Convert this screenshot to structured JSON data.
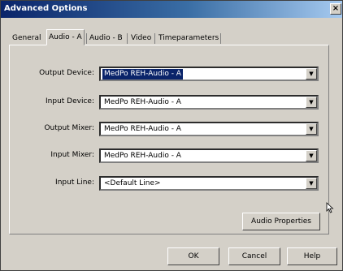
{
  "window": {
    "title": "Advanced Options",
    "close_label": "×"
  },
  "tabs": [
    {
      "label": "General",
      "active": false
    },
    {
      "label": "Audio - A",
      "active": true
    },
    {
      "label": "Audio - B",
      "active": false
    },
    {
      "label": "Video",
      "active": false
    },
    {
      "label": "Timeparameters",
      "active": false
    }
  ],
  "fields": [
    {
      "label": "Output Device:",
      "value": "MedPo REH-Audio - A",
      "selected": true
    },
    {
      "label": "Input Device:",
      "value": "MedPo REH-Audio - A",
      "selected": false
    },
    {
      "label": "Output Mixer:",
      "value": "MedPo REH-Audio - A",
      "selected": false
    },
    {
      "label": "Input Mixer:",
      "value": "MedPo REH-Audio - A",
      "selected": false
    },
    {
      "label": "Input Line:",
      "value": "<Default Line>",
      "selected": false
    }
  ],
  "buttons": {
    "audio_properties": "Audio Properties",
    "ok": "OK",
    "cancel": "Cancel",
    "help": "Help"
  }
}
